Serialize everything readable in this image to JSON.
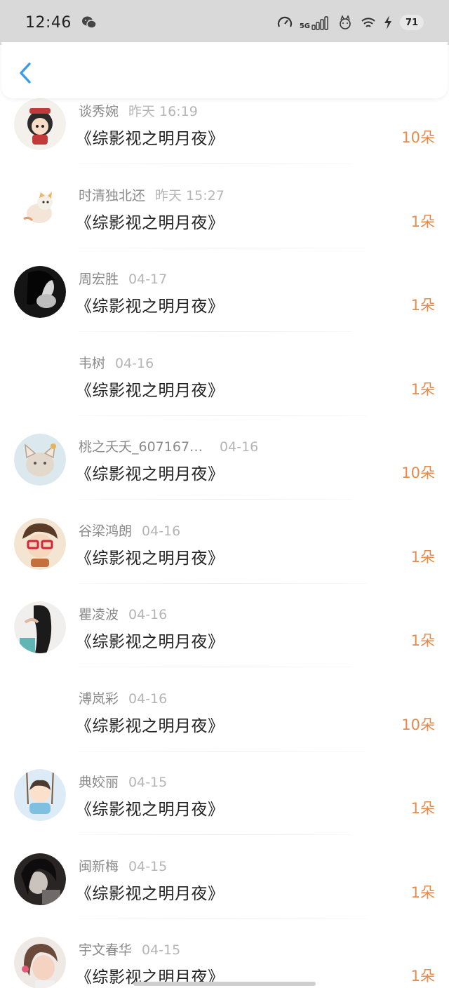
{
  "status_bar": {
    "time": "12:46",
    "network": "5G",
    "battery": "71"
  },
  "nav": {
    "back_icon": "chevron-left-icon",
    "accent": "#3a9ae8"
  },
  "colors": {
    "amount": "#e8894a",
    "name": "#8a8a8a",
    "date": "#b5b5b5"
  },
  "records": [
    {
      "name": "谈秀婉",
      "date": "昨天 16:19",
      "book": "《综影视之明月夜》",
      "amount": "10朵",
      "avatar": "cartoon-girl"
    },
    {
      "name": "时清独北还",
      "date": "昨天 15:27",
      "book": "《综影视之明月夜》",
      "amount": "1朵",
      "avatar": "cartoon-cat"
    },
    {
      "name": "周宏胜",
      "date": "04-17",
      "book": "《综影视之明月夜》",
      "amount": "1朵",
      "avatar": "dark-portrait"
    },
    {
      "name": "韦树",
      "date": "04-16",
      "book": "《综影视之明月夜》",
      "amount": "1朵",
      "avatar": ""
    },
    {
      "name": "桃之夭夭_607167…",
      "date": "04-16",
      "book": "《综影视之明月夜》",
      "amount": "10朵",
      "avatar": "cat-face"
    },
    {
      "name": "谷梁鸿朗",
      "date": "04-16",
      "book": "《综影视之明月夜》",
      "amount": "1朵",
      "avatar": "glasses-cartoon"
    },
    {
      "name": "瞿凌波",
      "date": "04-16",
      "book": "《综影视之明月夜》",
      "amount": "1朵",
      "avatar": "long-hair-girl"
    },
    {
      "name": "溥岚彩",
      "date": "04-16",
      "book": "《综影视之明月夜》",
      "amount": "10朵",
      "avatar": ""
    },
    {
      "name": "典姣丽",
      "date": "04-15",
      "book": "《综影视之明月夜》",
      "amount": "1朵",
      "avatar": "swing-cartoon"
    },
    {
      "name": "闽新梅",
      "date": "04-15",
      "book": "《综影视之明月夜》",
      "amount": "1朵",
      "avatar": "dark-girl"
    },
    {
      "name": "宇文春华",
      "date": "04-15",
      "book": "《综影视之明月夜》",
      "amount": "1朵",
      "avatar": "child-photo"
    }
  ]
}
